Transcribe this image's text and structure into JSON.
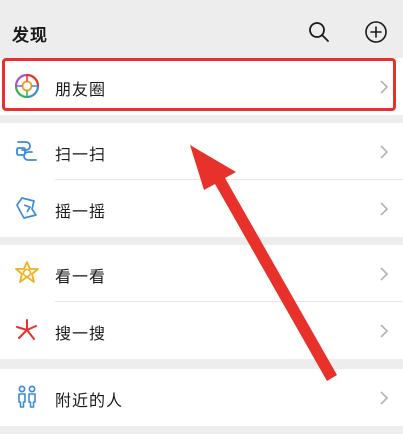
{
  "header": {
    "title": "发现",
    "search_icon": "search-icon",
    "add_icon": "plus-circle-icon"
  },
  "menu": {
    "moments": {
      "label": "朋友圈",
      "icon": "moments-aperture-icon"
    },
    "scan": {
      "label": "扫一扫",
      "icon": "scan-icon"
    },
    "shake": {
      "label": "摇一摇",
      "icon": "shake-icon"
    },
    "top_stories": {
      "label": "看一看",
      "icon": "top-stories-icon"
    },
    "search": {
      "label": "搜一搜",
      "icon": "search-sparkle-icon"
    },
    "nearby": {
      "label": "附近的人",
      "icon": "people-nearby-icon"
    }
  },
  "annotation": {
    "highlight_color": "#e8312a"
  }
}
